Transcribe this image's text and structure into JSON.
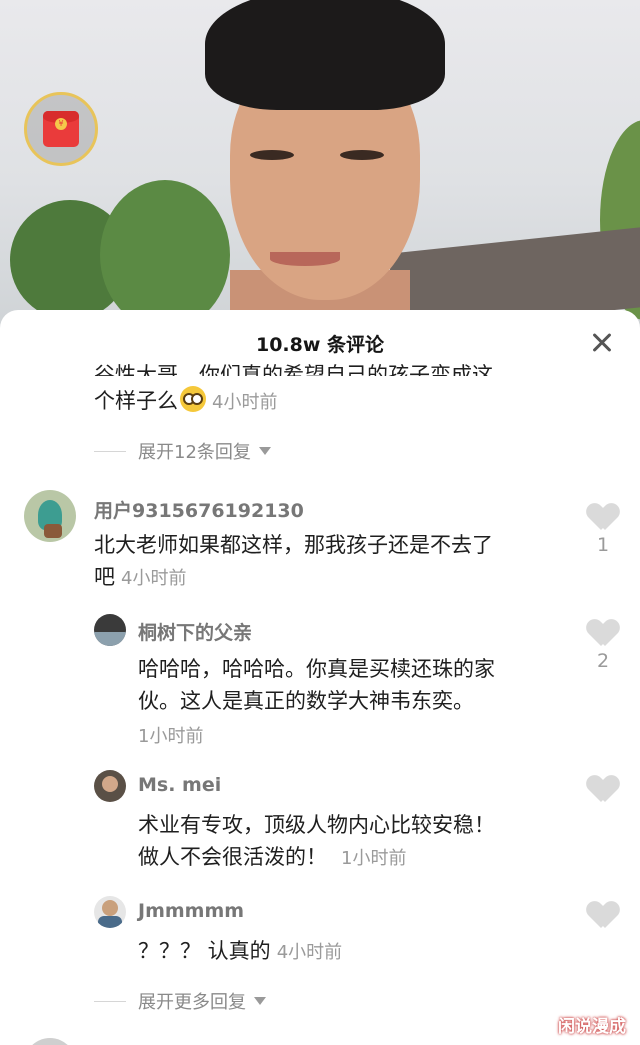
{
  "panel": {
    "title": "10.8w 条评论"
  },
  "top_comment": {
    "cut_text": "谷性大哥，你们真的希望自己的孩子变成这",
    "text": "个样子么",
    "emoji": "cool-emoji",
    "time": "4小时前",
    "expand_label": "展开12条回复"
  },
  "comments": [
    {
      "user": "用户9315676192130",
      "text_line1": "北大老师如果都这样，那我孩子还是不去了",
      "text_line2": "吧",
      "time": "4小时前",
      "likes": "1"
    }
  ],
  "replies": [
    {
      "user": "桐树下的父亲",
      "text_line1": "哈哈哈，哈哈哈。你真是买椟还珠的家",
      "text_line2": "伙。这人是真正的数学大神韦东奕。",
      "time": "1小时前",
      "likes": "2"
    },
    {
      "user": "Ms. mei",
      "text_line1": "术业有专攻，顶级人物内心比较安稳！",
      "text_line2": "做人不会很活泼的！",
      "time": "1小时前",
      "likes": ""
    },
    {
      "user": "Jmmmmm",
      "text_line1": "？？？ 认真的",
      "time": "4小时前",
      "likes": ""
    }
  ],
  "expand_more_label": "展开更多回复",
  "watermark": "闲说漫成",
  "icons": {
    "red_packet": "red-packet-icon",
    "close": "close-icon",
    "like": "heart-icon",
    "expand": "chevron-down-icon"
  }
}
